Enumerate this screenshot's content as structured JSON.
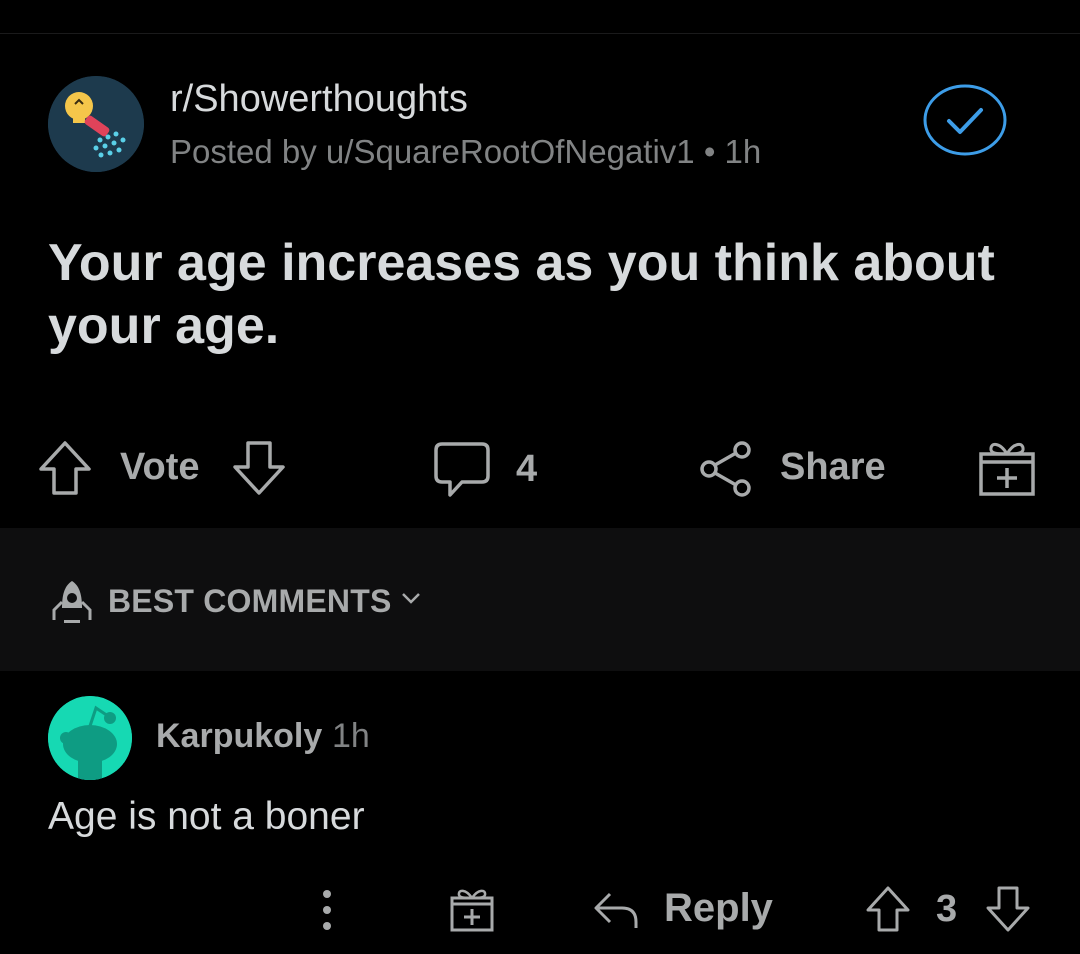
{
  "post": {
    "subreddit": "r/Showerthoughts",
    "posted_by": "Posted by u/SquareRootOfNegativ1 • 1h",
    "title": "Your age increases as you think about your age.",
    "subreddit_icon": "shower-lightbulb-icon"
  },
  "actions": {
    "vote_label": "Vote",
    "comment_count": "4",
    "share_label": "Share"
  },
  "sort": {
    "label": "BEST COMMENTS"
  },
  "comment": {
    "author": "Karpukoly",
    "time": "1h",
    "body": "Age is not a boner",
    "reply_label": "Reply",
    "score": "3"
  },
  "colors": {
    "background": "#000000",
    "text": "#d7dadc",
    "muted": "#818384",
    "accent_blue": "#3d9de8",
    "avatar_green": "#16d9b3"
  }
}
